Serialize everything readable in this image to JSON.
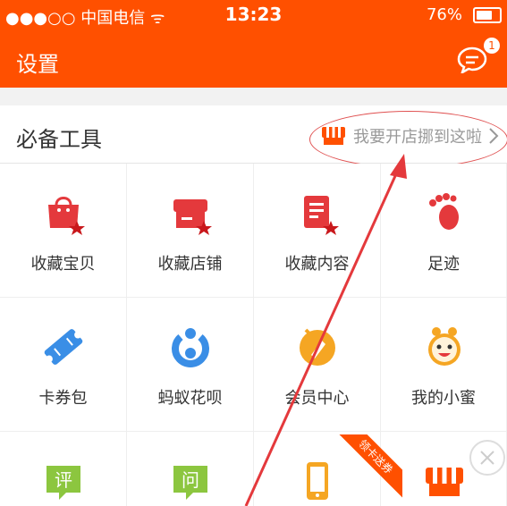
{
  "status": {
    "carrier": "●●●○○ 中国电信 ᯤ",
    "time": "13:23",
    "battery": "76%"
  },
  "nav": {
    "title": "设置",
    "badge": "1"
  },
  "section": {
    "title": "必备工具",
    "open_link": "我要开店挪到这啦"
  },
  "tools": [
    {
      "label": "收藏宝贝",
      "icon": "favorite-item-icon"
    },
    {
      "label": "收藏店铺",
      "icon": "favorite-shop-icon"
    },
    {
      "label": "收藏内容",
      "icon": "favorite-content-icon"
    },
    {
      "label": "足迹",
      "icon": "footprint-icon"
    },
    {
      "label": "卡券包",
      "icon": "coupon-icon"
    },
    {
      "label": "蚂蚁花呗",
      "icon": "huabei-icon"
    },
    {
      "label": "会员中心",
      "icon": "member-center-icon"
    },
    {
      "label": "我的小蜜",
      "icon": "assistant-icon"
    },
    {
      "label": "",
      "icon": "review-icon",
      "glyph": "评"
    },
    {
      "label": "",
      "icon": "question-icon",
      "glyph": "问"
    },
    {
      "label": "",
      "icon": "phone-topup-icon"
    },
    {
      "label": "",
      "icon": "shop-icon"
    }
  ],
  "ribbon": "领卡送券",
  "colors": {
    "brand": "#ff5000",
    "red": "#e4393c",
    "blue": "#3a8ee6",
    "green": "#8cc63f",
    "yellow": "#f5a623"
  }
}
